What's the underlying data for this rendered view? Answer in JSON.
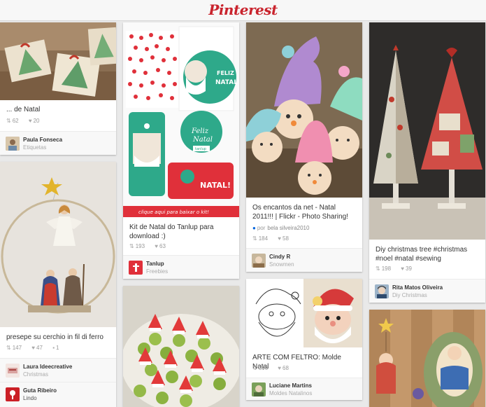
{
  "app": {
    "logo": "Pinterest"
  },
  "colors": {
    "brand": "#c9232d",
    "background": "#e9e9e9"
  },
  "pins": [
    {
      "description": "... de Natal",
      "repins": "62",
      "likes": "20",
      "user": "Paula Fonseca",
      "board": "Etiquetas"
    },
    {
      "description": "presepe su cerchio in fil di ferro",
      "repins": "147",
      "likes": "47",
      "comments": "1",
      "user": "Laura Ideecreative",
      "board": "Christmas",
      "second_user": "Guta Ribeiro",
      "second_board": "Lindo"
    },
    {
      "image_text": {
        "feliz": "FELIZ",
        "natal": "NATAL!",
        "feliz_script": "Feliz",
        "natal_script": "Natal",
        "brand_tag": "tanlup",
        "banner": "clique aqui para baixar o kit!"
      },
      "description": "Kit de Natal do Tanlup para download :)",
      "repins": "193",
      "likes": "63",
      "user": "Tanlup",
      "board": "Freebies"
    },
    {
      "description": ""
    },
    {
      "description": "Os encantos da net - Natal 2011!!! | Flickr - Photo Sharing!",
      "via_prefix": "por",
      "via": "bela silveira2010",
      "repins": "184",
      "likes": "58",
      "user": "Cindy R",
      "board": "Snowmen"
    },
    {
      "description": "ARTE COM FELTRO: Molde Natal",
      "repins": "316",
      "likes": "68",
      "user": "Luciane Martins",
      "board": "Moldes Natalinos"
    },
    {
      "description": "Diy christmas tree #christmas #noel #natal #sewing",
      "repins": "198",
      "likes": "39",
      "user": "Rita Matos Oliveira",
      "board": "Diy Christmas"
    },
    {
      "description": ""
    }
  ]
}
